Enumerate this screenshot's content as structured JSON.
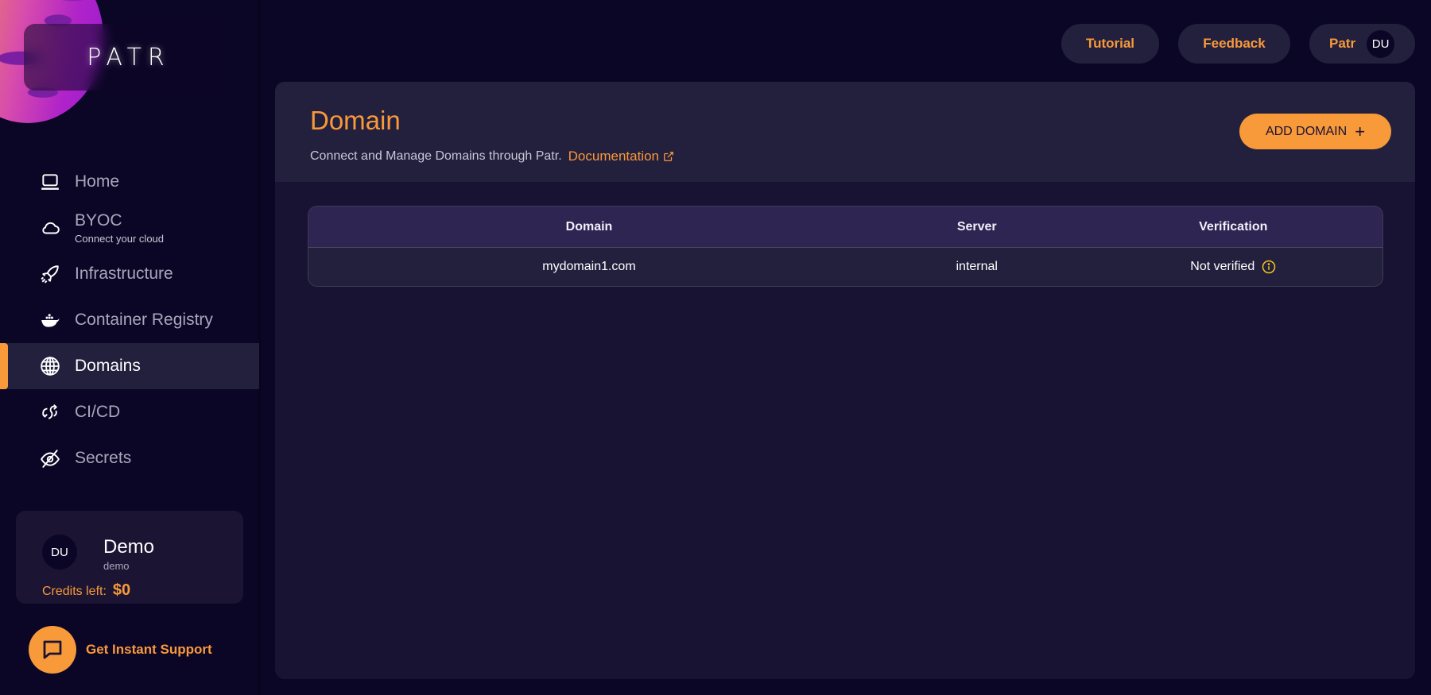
{
  "brand": {
    "logo_text": "PATR"
  },
  "sidebar": {
    "items": [
      {
        "label": "Home",
        "icon": "laptop-icon",
        "active": false
      },
      {
        "label": "BYOC",
        "sublabel": "Connect your cloud",
        "icon": "cloud-icon",
        "active": false
      },
      {
        "label": "Infrastructure",
        "icon": "rocket-icon",
        "active": false
      },
      {
        "label": "Container Registry",
        "icon": "docker-icon",
        "active": false
      },
      {
        "label": "Domains",
        "icon": "globe-icon",
        "active": true
      },
      {
        "label": "CI/CD",
        "icon": "sync-icon",
        "active": false
      },
      {
        "label": "Secrets",
        "icon": "eye-off-icon",
        "active": false
      }
    ],
    "user_card": {
      "initials": "DU",
      "name": "Demo",
      "handle": "demo",
      "credits_label": "Credits left:",
      "credits_value": "$0"
    },
    "support": {
      "label": "Get Instant Support",
      "icon": "chat-icon"
    }
  },
  "topbar": {
    "tutorial_label": "Tutorial",
    "feedback_label": "Feedback",
    "account_name": "Patr",
    "account_initials": "DU"
  },
  "main": {
    "title": "Domain",
    "description": "Connect and Manage Domains through Patr.",
    "doc_link_label": "Documentation",
    "add_button_label": "ADD DOMAIN",
    "table": {
      "columns": [
        "Domain",
        "Server",
        "Verification"
      ],
      "rows": [
        {
          "domain": "mydomain1.com",
          "server": "internal",
          "verification": "Not verified"
        }
      ]
    }
  },
  "colors": {
    "accent": "#f8993a",
    "background": "#0c0626",
    "panel": "#23203e",
    "table_header": "#2e2552",
    "warning_icon": "#f5c518"
  }
}
